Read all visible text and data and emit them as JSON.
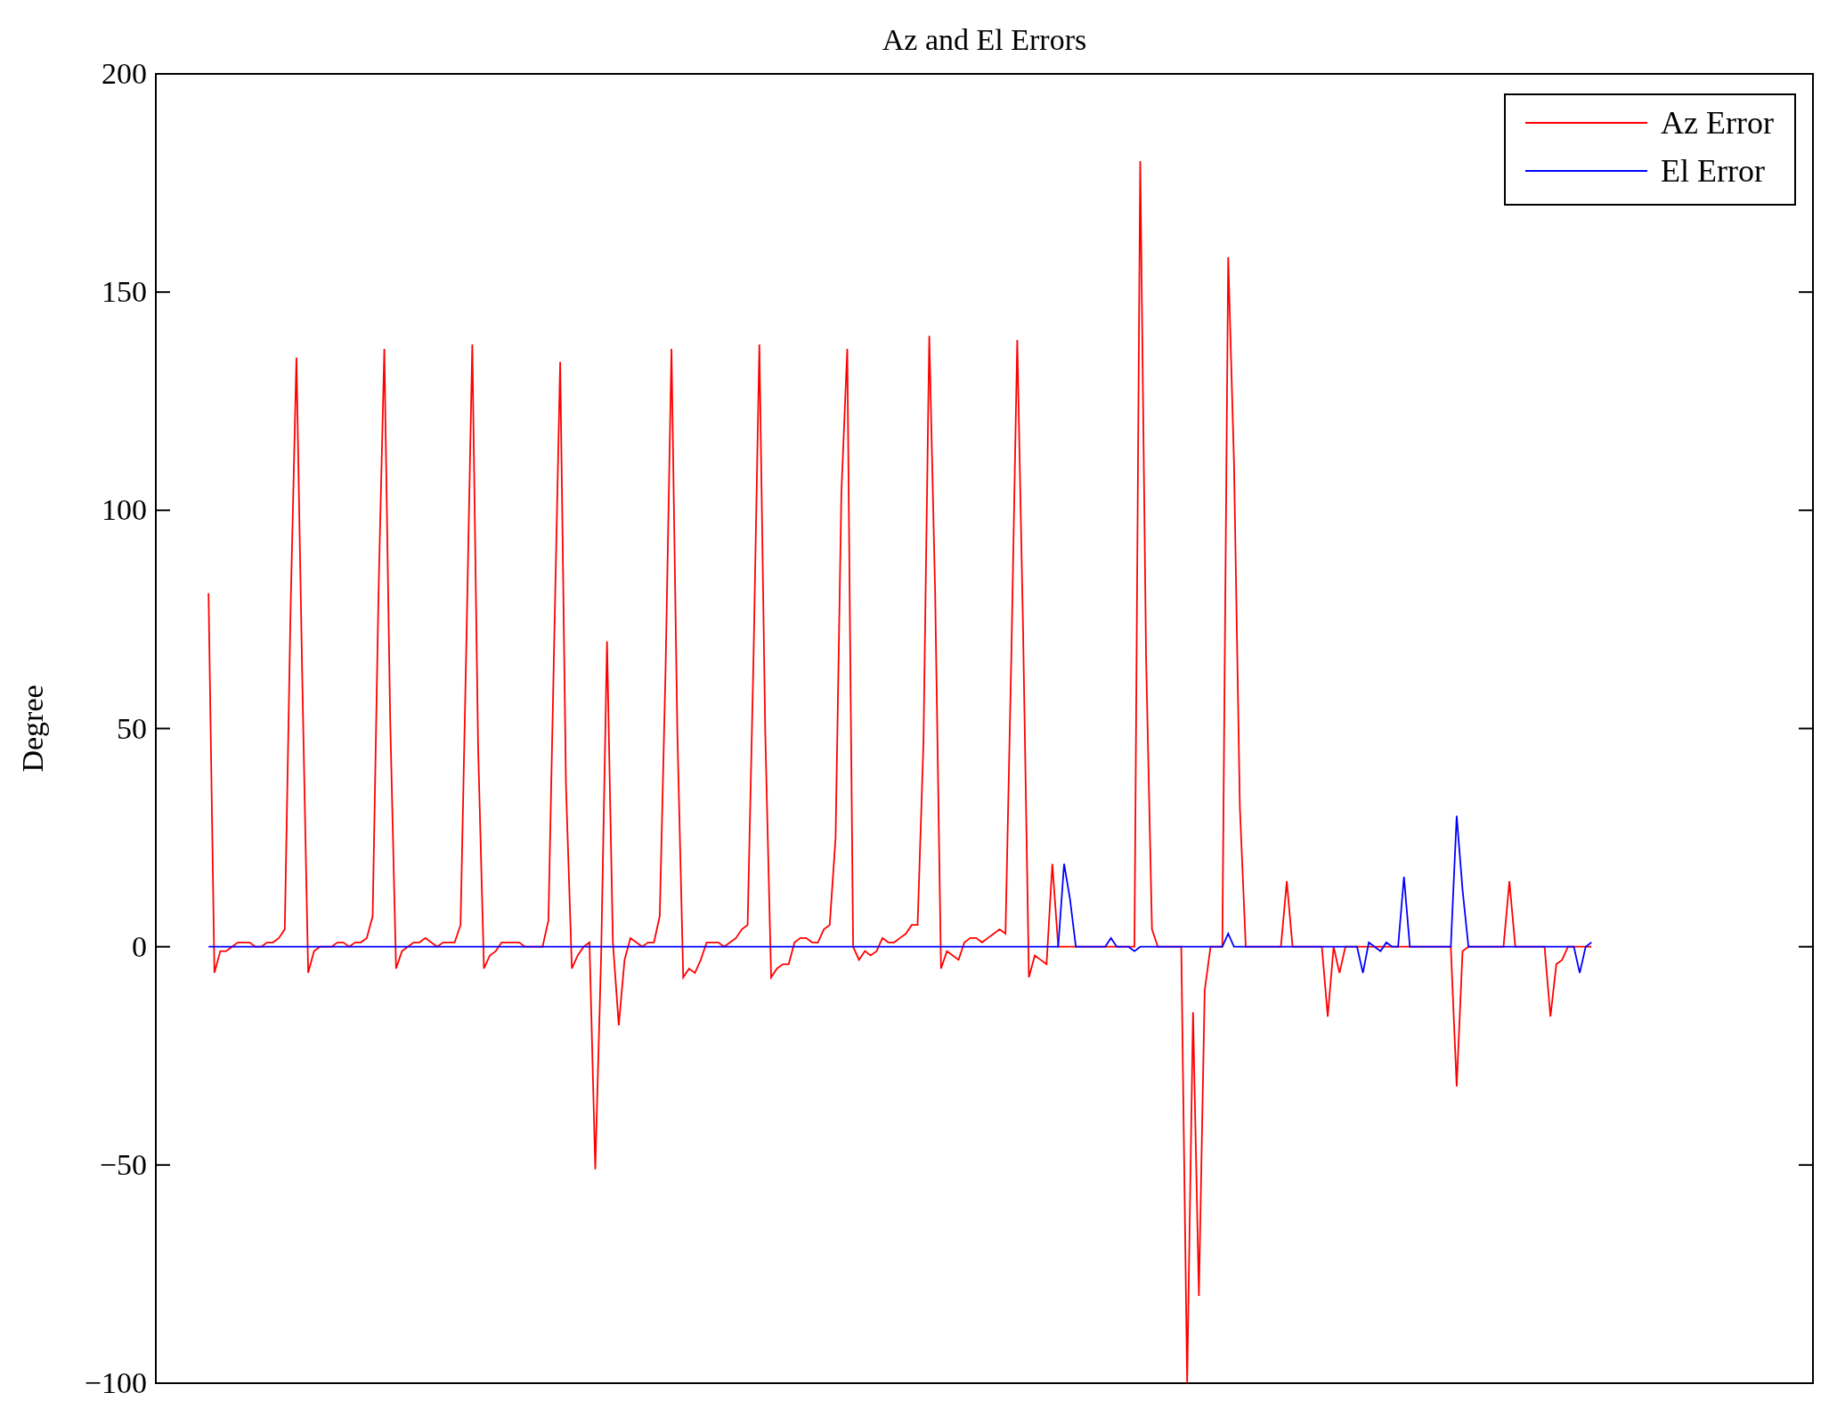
{
  "figure": {
    "chart_data": {
      "type": "line",
      "title": "Az and El Errors",
      "ylabel": "Degree",
      "ylim": [
        -100,
        200
      ],
      "legend": true,
      "yticks": [
        {
          "value": -100,
          "label": "−100"
        },
        {
          "value": -50,
          "label": "−50"
        },
        {
          "value": 0,
          "label": "0"
        },
        {
          "value": 50,
          "label": "50"
        },
        {
          "value": 100,
          "label": "100"
        },
        {
          "value": 150,
          "label": "150"
        },
        {
          "value": 200,
          "label": "200"
        }
      ],
      "categories": [
        null,
        null,
        null,
        null,
        null,
        null,
        null,
        null,
        null,
        null,
        null,
        null,
        null,
        null,
        null,
        null,
        null,
        null,
        null,
        null,
        null,
        null,
        null,
        null,
        null,
        null,
        null,
        null,
        null,
        null,
        null,
        null,
        null,
        null,
        null,
        null,
        null,
        null,
        null,
        null,
        null,
        null,
        null,
        null,
        null,
        null,
        null,
        null,
        null,
        null,
        null,
        null,
        null,
        null,
        null,
        null,
        null,
        null,
        null,
        null,
        null,
        null,
        null,
        null,
        null,
        null,
        null,
        null,
        null,
        null,
        null,
        null,
        null,
        null,
        null,
        null,
        null,
        null,
        null,
        null,
        null,
        null,
        null,
        null,
        null,
        null,
        null,
        null,
        null,
        null,
        null,
        null,
        null,
        null,
        null,
        null,
        null,
        null,
        null,
        null,
        null,
        null,
        null,
        null,
        null,
        null,
        null,
        null,
        null,
        null,
        null,
        null,
        null,
        null,
        null,
        null,
        null,
        null,
        null,
        null,
        null,
        null,
        null,
        null,
        null,
        null,
        null,
        null,
        null,
        null,
        null,
        null,
        null,
        null,
        null,
        null,
        null,
        null,
        null,
        null,
        null,
        null,
        null,
        null,
        null,
        null,
        null,
        null,
        null,
        null,
        null,
        null,
        null,
        null,
        null,
        null,
        null,
        null,
        null,
        null,
        null,
        null,
        null,
        null,
        null,
        null,
        null,
        null,
        null,
        null,
        null,
        null,
        null,
        null,
        null,
        null,
        null,
        null,
        null,
        null,
        null,
        null,
        null,
        null,
        null,
        null,
        null,
        null,
        null,
        null,
        null,
        null,
        null,
        null,
        null,
        null,
        null,
        null,
        null,
        null,
        null,
        null,
        null,
        null,
        null,
        null,
        null,
        null,
        null,
        null,
        null,
        null,
        null,
        null,
        null,
        null,
        null,
        null,
        null,
        null,
        null,
        null,
        null,
        null,
        null,
        null,
        null,
        null,
        null,
        null,
        null,
        null,
        null,
        null,
        null,
        null,
        null
      ],
      "series": [
        {
          "name": "Az Error",
          "color": "#ff0000",
          "values": [
            81,
            -6,
            -1,
            -1,
            0,
            1,
            1,
            1,
            0,
            0,
            1,
            1,
            2,
            4,
            78,
            135,
            61,
            -6,
            -1,
            0,
            0,
            0,
            1,
            1,
            0,
            1,
            1,
            2,
            7,
            81,
            137,
            52,
            -5,
            -1,
            0,
            1,
            1,
            2,
            1,
            0,
            1,
            1,
            1,
            5,
            70,
            138,
            46,
            -5,
            -2,
            -1,
            1,
            1,
            1,
            1,
            0,
            0,
            0,
            0,
            6,
            71,
            134,
            37,
            -5,
            -2,
            0,
            1,
            -51,
            -2,
            70,
            1,
            -18,
            -3,
            2,
            1,
            0,
            1,
            1,
            7,
            64,
            137,
            49,
            -7,
            -5,
            -6,
            -3,
            1,
            1,
            1,
            0,
            1,
            2,
            4,
            5,
            66,
            138,
            49,
            -7,
            -5,
            -4,
            -4,
            1,
            2,
            2,
            1,
            1,
            4,
            5,
            25,
            104,
            137,
            0,
            -3,
            -1,
            -2,
            -1,
            2,
            1,
            1,
            2,
            3,
            5,
            5,
            47,
            140,
            81,
            -5,
            -1,
            -2,
            -3,
            1,
            2,
            2,
            1,
            2,
            3,
            4,
            3,
            67,
            139,
            73,
            -7,
            -2,
            -3,
            -4,
            19,
            0,
            0,
            0,
            0,
            0,
            0,
            0,
            0,
            0,
            0,
            0,
            0,
            0,
            0,
            180,
            66,
            4,
            0,
            0,
            0,
            0,
            0,
            -100,
            -15,
            -80,
            -10,
            0,
            0,
            0,
            158,
            111,
            32,
            0,
            0,
            0,
            0,
            0,
            0,
            0,
            15,
            0,
            0,
            0,
            0,
            0,
            0,
            -16,
            0,
            -6,
            0,
            0,
            0,
            0,
            0,
            0,
            0,
            0,
            0,
            0,
            0,
            0,
            0,
            0,
            0,
            0,
            0,
            0,
            0,
            -32,
            -1,
            0,
            0,
            0,
            0,
            0,
            0,
            0,
            15,
            0,
            0,
            0,
            0,
            0,
            0,
            -16,
            -4,
            -3,
            0,
            0,
            0,
            0,
            0
          ]
        },
        {
          "name": "El Error",
          "color": "#0000ff",
          "values": [
            0,
            0,
            0,
            0,
            0,
            0,
            0,
            0,
            0,
            0,
            0,
            0,
            0,
            0,
            0,
            0,
            0,
            0,
            0,
            0,
            0,
            0,
            0,
            0,
            0,
            0,
            0,
            0,
            0,
            0,
            0,
            0,
            0,
            0,
            0,
            0,
            0,
            0,
            0,
            0,
            0,
            0,
            0,
            0,
            0,
            0,
            0,
            0,
            0,
            0,
            0,
            0,
            0,
            0,
            0,
            0,
            0,
            0,
            0,
            0,
            0,
            0,
            0,
            0,
            0,
            0,
            0,
            0,
            0,
            0,
            0,
            0,
            0,
            0,
            0,
            0,
            0,
            0,
            0,
            0,
            0,
            0,
            0,
            0,
            0,
            0,
            0,
            0,
            0,
            0,
            0,
            0,
            0,
            0,
            0,
            0,
            0,
            0,
            0,
            0,
            0,
            0,
            0,
            0,
            0,
            0,
            0,
            0,
            0,
            0,
            0,
            0,
            0,
            0,
            0,
            0,
            0,
            0,
            0,
            0,
            0,
            0,
            0,
            0,
            0,
            0,
            0,
            0,
            0,
            0,
            0,
            0,
            0,
            0,
            0,
            0,
            0,
            0,
            0,
            0,
            0,
            0,
            0,
            0,
            0,
            0,
            19,
            11,
            0,
            0,
            0,
            0,
            0,
            0,
            2,
            0,
            0,
            0,
            -1,
            0,
            0,
            0,
            0,
            0,
            0,
            0,
            0,
            0,
            0,
            0,
            0,
            0,
            0,
            0,
            3,
            0,
            0,
            0,
            0,
            0,
            0,
            0,
            0,
            0,
            0,
            0,
            0,
            0,
            0,
            0,
            0,
            0,
            0,
            0,
            0,
            0,
            0,
            -6,
            1,
            0,
            -1,
            1,
            0,
            0,
            16,
            0,
            0,
            0,
            0,
            0,
            0,
            0,
            0,
            30,
            13,
            0,
            0,
            0,
            0,
            0,
            0,
            0,
            0,
            0,
            0,
            0,
            0,
            0,
            0,
            0,
            0,
            0,
            0,
            0,
            -6,
            0,
            1
          ]
        }
      ]
    }
  }
}
